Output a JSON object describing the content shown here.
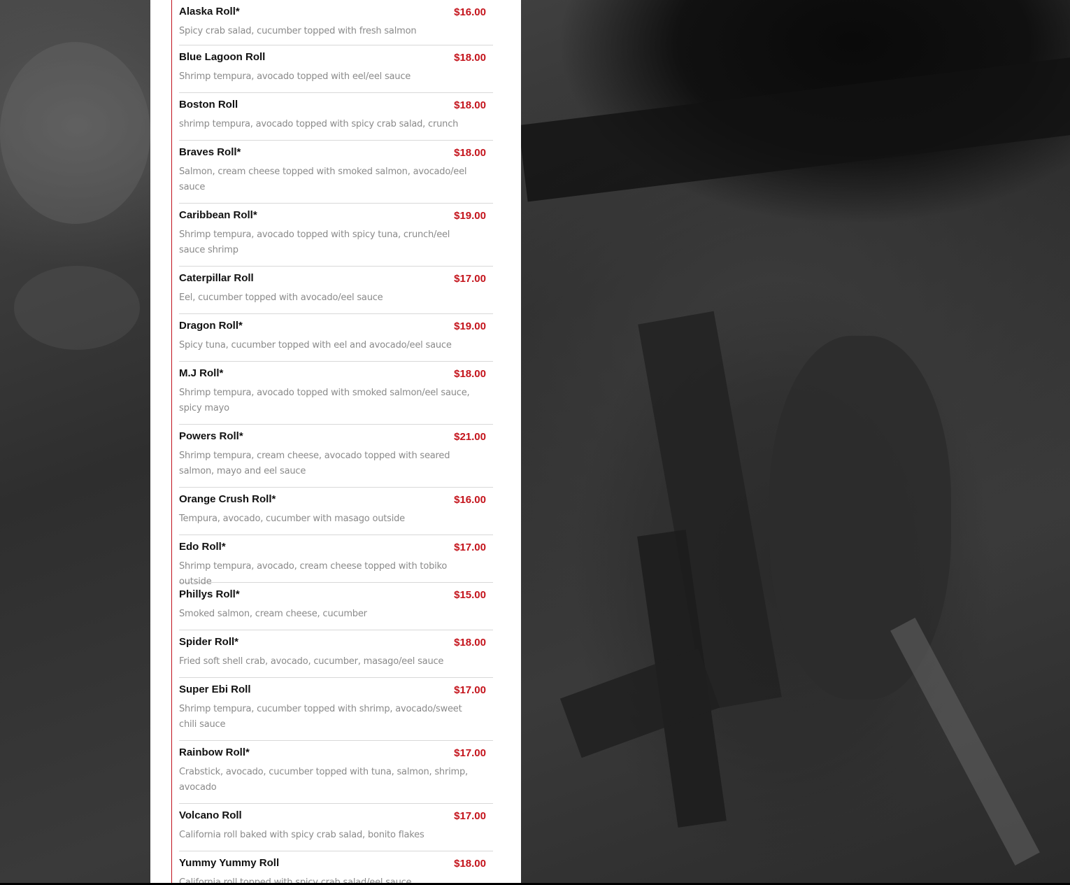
{
  "menu": {
    "items": [
      {
        "name": "Alaska Roll*",
        "price": "$16.00",
        "description": "Spicy crab salad, cucumber topped with fresh salmon"
      },
      {
        "name": "Blue Lagoon Roll",
        "price": "$18.00",
        "description": "Shrimp tempura, avocado topped with eel/eel sauce"
      },
      {
        "name": "Boston Roll",
        "price": "$18.00",
        "description": "shrimp tempura, avocado topped with spicy crab salad, crunch"
      },
      {
        "name": "Braves Roll*",
        "price": "$18.00",
        "description": "Salmon, cream cheese topped with smoked salmon, avocado/eel sauce"
      },
      {
        "name": "Caribbean Roll*",
        "price": "$19.00",
        "description": "Shrimp tempura, avocado topped with spicy tuna, crunch/eel sauce shrimp"
      },
      {
        "name": "Caterpillar Roll",
        "price": "$17.00",
        "description": "Eel, cucumber topped with avocado/eel sauce"
      },
      {
        "name": "Dragon Roll*",
        "price": "$19.00",
        "description": "Spicy tuna, cucumber topped with eel and avocado/eel sauce"
      },
      {
        "name": "M.J Roll*",
        "price": "$18.00",
        "description": "Shrimp tempura, avocado topped with smoked salmon/eel sauce, spicy mayo"
      },
      {
        "name": "Powers Roll*",
        "price": "$21.00",
        "description": "Shrimp tempura, cream cheese, avocado topped with seared salmon, mayo and eel sauce"
      },
      {
        "name": "Orange Crush Roll*",
        "price": "$16.00",
        "description": "Tempura, avocado, cucumber with masago outside"
      },
      {
        "name": "Edo Roll*",
        "price": "$17.00",
        "description": "Shrimp tempura, avocado, cream cheese topped with tobiko outside"
      },
      {
        "name": "Phillys Roll*",
        "price": "$15.00",
        "description": "Smoked salmon, cream cheese, cucumber"
      },
      {
        "name": "Spider Roll*",
        "price": "$18.00",
        "description": "Fried soft shell crab, avocado, cucumber, masago/eel sauce"
      },
      {
        "name": "Super Ebi Roll",
        "price": "$17.00",
        "description": "Shrimp tempura, cucumber topped with shrimp, avocado/sweet chili sauce"
      },
      {
        "name": "Rainbow Roll*",
        "price": "$17.00",
        "description": "Crabstick, avocado, cucumber topped with tuna, salmon, shrimp, avocado"
      },
      {
        "name": "Volcano Roll",
        "price": "$17.00",
        "description": "California roll baked with spicy crab salad, bonito flakes"
      },
      {
        "name": "Yummy Yummy Roll",
        "price": "$18.00",
        "description": "California roll topped with spicy crab salad/eel sauce"
      }
    ]
  },
  "colors": {
    "price": "#c4141c",
    "accent_rule": "#c0121c",
    "name": "#111111",
    "description": "#8a8a8a"
  }
}
